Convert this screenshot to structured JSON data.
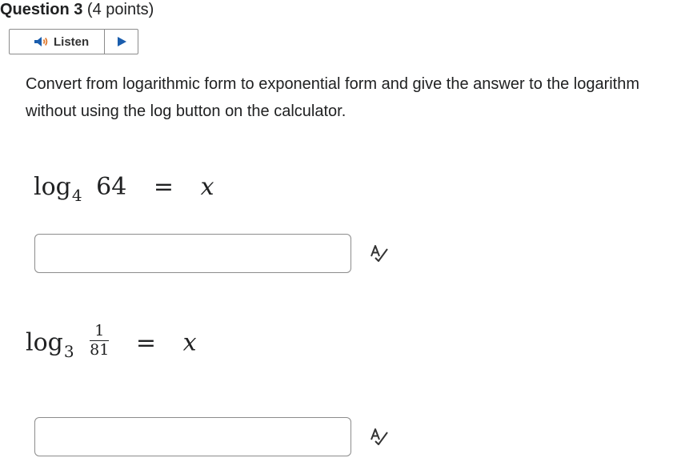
{
  "question": {
    "number_label": "Question 3",
    "points_label": "(4 points)"
  },
  "listen": {
    "label": "Listen",
    "icons": [
      "speaker-icon",
      "play-icon"
    ],
    "speaker_color": "#1a5dad",
    "speaker_wave_color": "#e07a2f",
    "play_color": "#1a5dad"
  },
  "prompt": "Convert from logarithmic form to exponential form and give the answer to the logarithm without using the log button on the calculator.",
  "problems": [
    {
      "log": "log",
      "base": "4",
      "argument": "64",
      "equals": "=",
      "variable": "x",
      "answer_value": ""
    },
    {
      "log": "log",
      "base": "3",
      "argument_numerator": "1",
      "argument_denominator": "81",
      "equals": "=",
      "variable": "x",
      "answer_value": ""
    }
  ],
  "tools": {
    "spell_check_icon": "spell-check-icon"
  }
}
